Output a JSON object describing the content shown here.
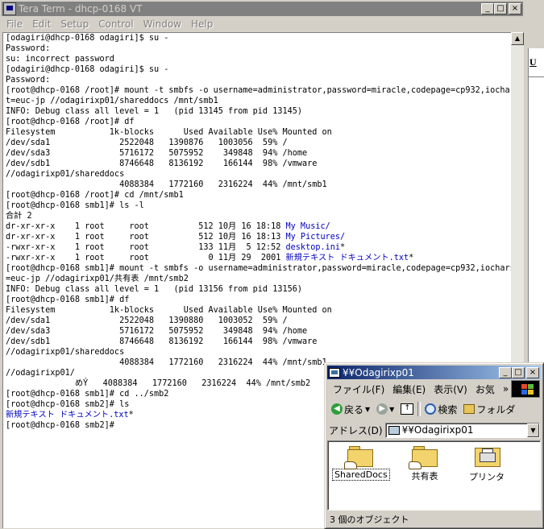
{
  "teraterm": {
    "title": "Tera Term - dhcp-0168 VT",
    "menu": [
      "File",
      "Edit",
      "Setup",
      "Control",
      "Window",
      "Help"
    ],
    "terminal_lines": [
      {
        "text": "[odagiri@dhcp-0168 odagiri]$ su -"
      },
      {
        "text": "Password:"
      },
      {
        "text": "su: incorrect password"
      },
      {
        "text": "[odagiri@dhcp-0168 odagiri]$ su -"
      },
      {
        "text": "Password:"
      },
      {
        "text": "[root@dhcp-0168 /root]# mount -t smbfs -o username=administrator,password=miracle,codepage=cp932,iocharse"
      },
      {
        "text": "t=euc-jp //odagirixp01/shareddocs /mnt/smb1"
      },
      {
        "text": "INFO: Debug class all level = 1   (pid 13145 from pid 13145)"
      },
      {
        "text": "[root@dhcp-0168 /root]# df"
      },
      {
        "text": "Filesystem           1k-blocks      Used Available Use% Mounted on"
      },
      {
        "text": "/dev/sda1              2522048   1390876   1003056  59% /"
      },
      {
        "text": "/dev/sda3              5716172   5075952    349848  94% /home"
      },
      {
        "text": "/dev/sdb1              8746648   8136192    166144  98% /vmware"
      },
      {
        "text": "//odagirixp01/shareddocs"
      },
      {
        "text": "                       4088384   1772160   2316224  44% /mnt/smb1"
      },
      {
        "text": "[root@dhcp-0168 /root]# cd /mnt/smb1"
      },
      {
        "text": "[root@dhcp-0168 smb1]# ls -l"
      },
      {
        "text": "合計 2"
      },
      {
        "text": "dr-xr-xr-x    1 root     root          512 10月 16 18:18 ",
        "blue": "My Music/"
      },
      {
        "text": "dr-xr-xr-x    1 root     root          512 10月 16 18:13 ",
        "blue": "My Pictures/"
      },
      {
        "text": "-rwxr-xr-x    1 root     root          133 11月  5 12:52 ",
        "blue": "desktop.ini",
        "tail": "*"
      },
      {
        "text": "-rwxr-xr-x    1 root     root            0 11月 29  2001 ",
        "blue": "新規テキスト ドキュメント.txt",
        "tail": "*"
      },
      {
        "text": "[root@dhcp-0168 smb1]# mount -t smbfs -o username=administrator,password=miracle,codepage=cp932,iocharset"
      },
      {
        "text": "=euc-jp //odagirixp01/共有表 /mnt/smb2"
      },
      {
        "text": "INFO: Debug class all level = 1   (pid 13156 from pid 13156)"
      },
      {
        "text": "[root@dhcp-0168 smb1]# df"
      },
      {
        "text": "Filesystem           1k-blocks      Used Available Use% Mounted on"
      },
      {
        "text": "/dev/sda1              2522048   1390880   1003052  59% /"
      },
      {
        "text": "/dev/sda3              5716172   5075952    349848  94% /home"
      },
      {
        "text": "/dev/sdb1              8746648   8136192    166144  98% /vmware"
      },
      {
        "text": "//odagirixp01/shareddocs"
      },
      {
        "text": "                       4088384   1772160   2316224  44% /mnt/smb1"
      },
      {
        "text": "//odagirixp01/"
      },
      {
        "text": "              めÝ   4088384   1772160   2316224  44% /mnt/smb2"
      },
      {
        "text": "[root@dhcp-0168 smb1]# cd ../smb2"
      },
      {
        "text": "[root@dhcp-0168 smb2]# ls"
      },
      {
        "text": "",
        "blue": "新規テキスト ドキュメント.txt",
        "tail": "*"
      },
      {
        "text": "[root@dhcp-0168 smb2]# "
      }
    ]
  },
  "background_window": {
    "toolbar_glyph": "U"
  },
  "explorer": {
    "title": "¥¥Odagirixp01",
    "menu": [
      "ファイル(F)",
      "編集(E)",
      "表示(V)",
      "お気"
    ],
    "menu_overflow": "»",
    "toolbar": {
      "back_label": "戻る",
      "search_label": "検索",
      "folders_label": "フォルダ"
    },
    "address": {
      "label": "アドレス(D)",
      "value": "¥¥Odagirixp01"
    },
    "items": [
      {
        "label": "SharedDocs",
        "type": "shared-folder"
      },
      {
        "label": "共有表",
        "type": "shared-folder"
      },
      {
        "label": "プリンタ",
        "type": "printers-folder"
      }
    ],
    "status": "3 個のオブジェクト"
  },
  "colors": {
    "terminal_link_blue": "#0000c0",
    "explorer_title_active": "#0a246a",
    "teraterm_title_inactive": "#808080"
  }
}
